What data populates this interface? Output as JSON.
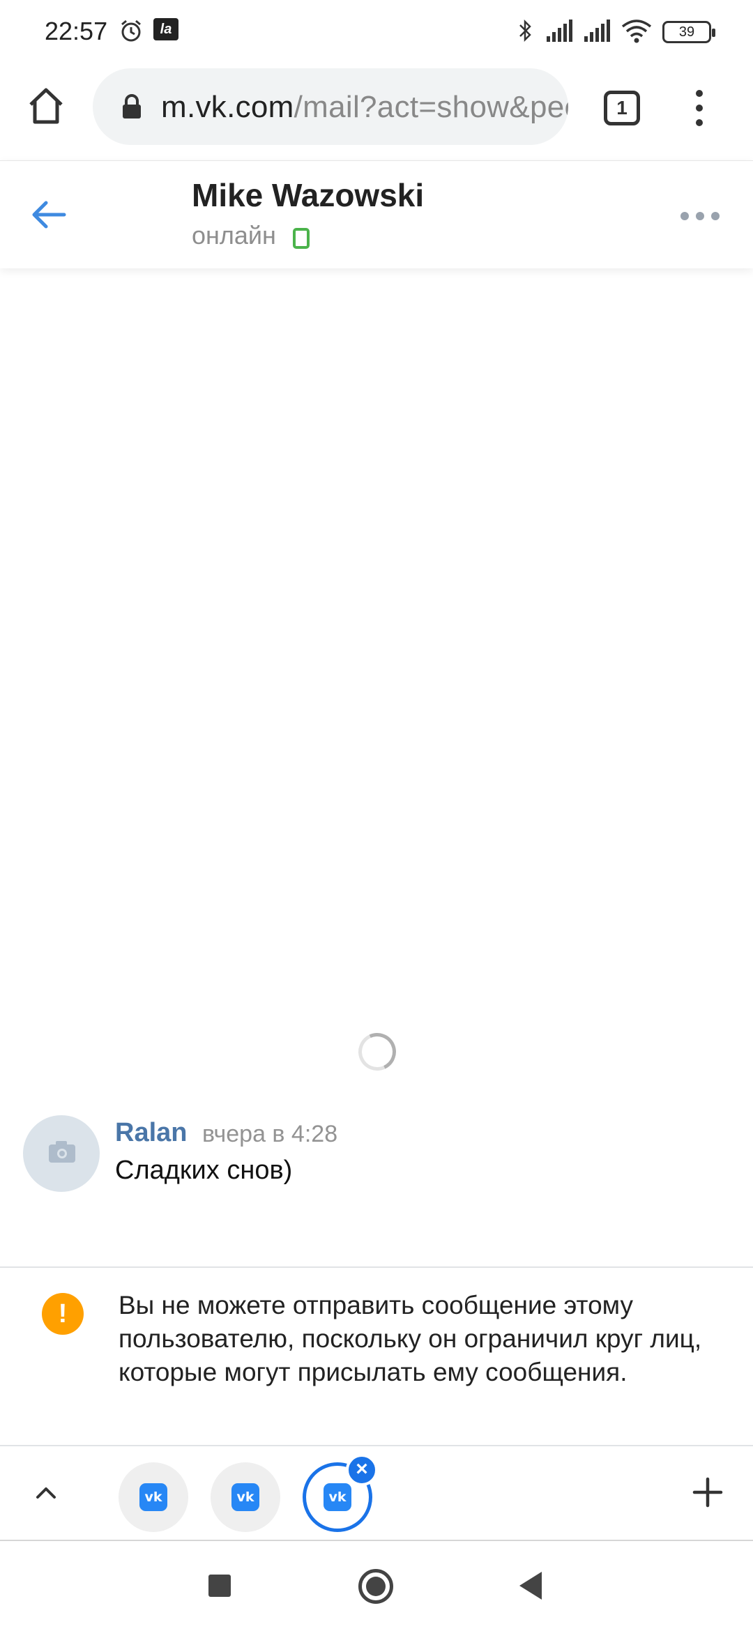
{
  "status_bar": {
    "time": "22:57",
    "la_badge": "la",
    "battery": "39",
    "icons": [
      "alarm-icon",
      "la-app-icon",
      "bluetooth-icon",
      "signal-icon",
      "signal-icon",
      "wifi-icon",
      "battery-icon"
    ]
  },
  "browser": {
    "url_host": "m.vk.com",
    "url_path": "/mail?act=show&peer",
    "tab_count": "1"
  },
  "chat_header": {
    "contact_name": "Mike Wazowski",
    "status": "онлайн"
  },
  "messages": [
    {
      "author": "Ralan",
      "time": "вчера в 4:28",
      "text": "Сладких снов)"
    }
  ],
  "notice": {
    "icon": "!",
    "text": "Вы не можете отправить сообщение этому пользователю, поскольку он ограничил круг лиц, которые могут присылать ему сообщения."
  },
  "tab_switcher": {
    "tabs": [
      {
        "icon_label": "vk",
        "active": false
      },
      {
        "icon_label": "vk",
        "active": false
      },
      {
        "icon_label": "vk",
        "active": true
      }
    ],
    "close_glyph": "×"
  },
  "colors": {
    "vk_blue": "#4a76a8",
    "online_green": "#4bb34b",
    "warning_orange": "#ffa000",
    "chrome_blue": "#1a73e8"
  }
}
